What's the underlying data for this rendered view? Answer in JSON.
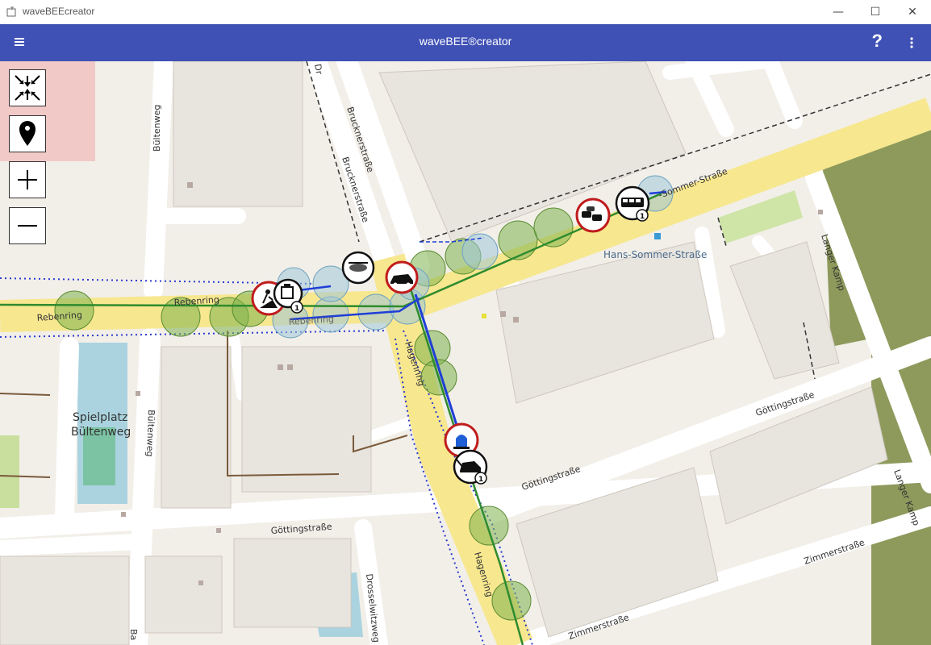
{
  "window": {
    "title": "waveBEEcreator",
    "controls": {
      "minimize": "—",
      "maximize": "☐",
      "close": "✕"
    }
  },
  "appbar": {
    "title": "waveBEE®creator",
    "help": "?",
    "colors": {
      "bar": "#3f51b5",
      "text": "#ffffff"
    }
  },
  "map": {
    "controls": [
      "recenter-icon",
      "location-pin-icon",
      "zoom-in-icon",
      "zoom-out-icon"
    ],
    "labels": {
      "rebenring_1": "Rebenring",
      "rebenring_2": "Rebenring",
      "rebenring_3": "Rebenring",
      "bultenweg_1": "Bültenweg",
      "bultenweg_2": "Bültenweg",
      "brucknerstrasse_1": "Brucknerstraße",
      "brucknerstrasse_2": "Brucknerstraße",
      "hans_sommer_strasse": "-Sommer-Straße",
      "hans_sommer_stop": "Hans-Sommer-Straße",
      "hagenring_1": "Hagenring",
      "hagenring_2": "Hagenring",
      "spielplatz_1": "Spielplatz",
      "spielplatz_2": "Bültenweg",
      "gottingstrasse_1": "Göttingstraße",
      "gottingstrasse_2": "Göttingstraße",
      "gottingstrasse_3": "Göttingstraße",
      "zimmerstrasse_1": "Zimmerstraße",
      "zimmerstrasse_2": "Zimmerstraße",
      "langer_kamp_1": "Langer Kamp",
      "langer_kamp_2": "Langer Kamp",
      "drosselwitzweg": "Drosselwitzweg",
      "ba": "Ba",
      "dr": "Dr"
    },
    "badges": {
      "construction": "1",
      "bus": "1",
      "tow": "1"
    },
    "markers": [
      "construction-sign-icon",
      "roadwork-vehicle-icon",
      "speed-camera-icon",
      "car-breakdown-icon",
      "traffic-jam-icon",
      "bus-icon",
      "police-light-icon",
      "tow-truck-icon"
    ],
    "colors": {
      "primary_road": "#f7e78f",
      "road": "#ffffff",
      "building": "#d9d0c9",
      "park": "#c8df9e",
      "water": "#aad3df",
      "forest": "#8d9a5c",
      "track_green": "#2e8b2e",
      "track_blue": "#1f3fd6",
      "circle_green": "#7fb24f",
      "circle_blue": "#9fc6d8",
      "sign_red": "#c01c1c"
    }
  }
}
